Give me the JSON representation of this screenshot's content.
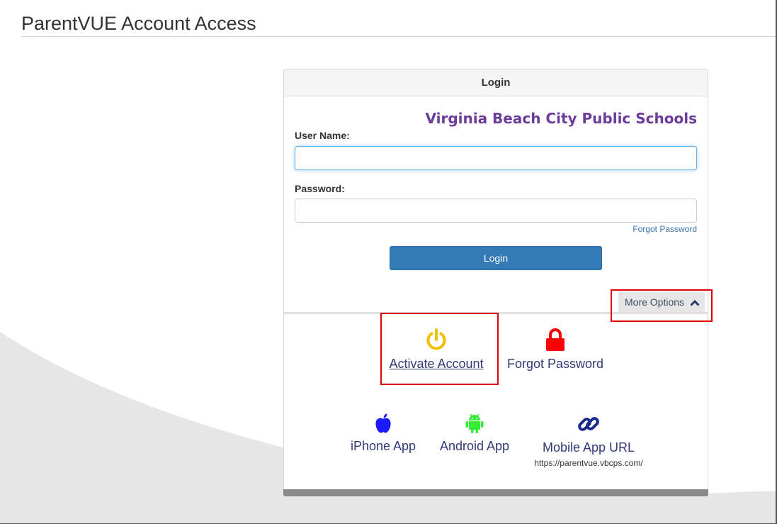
{
  "page": {
    "title": "ParentVUE Account Access"
  },
  "login_panel": {
    "header": "Login",
    "school_name": "Virginia Beach City Public Schools",
    "username_label": "User Name:",
    "username_value": "",
    "password_label": "Password:",
    "password_value": "",
    "forgot_password_link": "Forgot Password",
    "login_button": "Login",
    "more_options_label": "More Options"
  },
  "options": {
    "activate_account": {
      "label": "Activate Account",
      "icon": "power-icon",
      "color": "#f0c000"
    },
    "forgot_password": {
      "label": "Forgot Password",
      "icon": "lock-icon",
      "color": "#ff0000"
    },
    "iphone_app": {
      "label": "iPhone App",
      "icon": "apple-icon",
      "color": "#1a1aff"
    },
    "android_app": {
      "label": "Android App",
      "icon": "android-icon",
      "color": "#33ee33"
    },
    "mobile_app_url": {
      "label": "Mobile App URL",
      "url": "https://parentvue.vbcps.com/",
      "icon": "link-icon",
      "color": "#1a2a8a"
    }
  },
  "colors": {
    "accent": "#337ab7",
    "school": "#6a3d9a",
    "highlight": "#e00000",
    "link": "#333a78"
  }
}
